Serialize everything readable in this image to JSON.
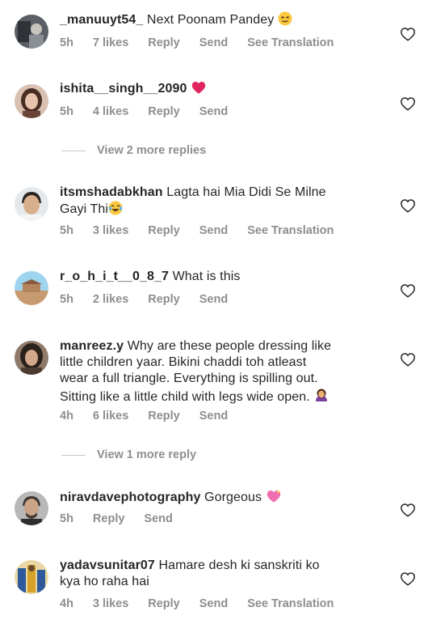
{
  "comments": [
    {
      "username": "_manuuyt54_",
      "text": "Next Poonam Pandey",
      "emoji": "persevering-face",
      "time": "5h",
      "likes": "7 likes",
      "reply": "Reply",
      "send": "Send",
      "translation": "See Translation"
    },
    {
      "username": "ishita__singh__2090",
      "text": "",
      "emoji": "red-heart",
      "time": "5h",
      "likes": "4 likes",
      "reply": "Reply",
      "send": "Send"
    },
    {
      "username": "itsmshadabkhan",
      "text": "Lagta hai Mia Didi Se Milne",
      "text_line2": "Gayi Thi",
      "emoji": "tears-of-joy",
      "time": "5h",
      "likes": "3 likes",
      "reply": "Reply",
      "send": "Send",
      "translation": "See Translation"
    },
    {
      "username": "r_o_h_i_t__0_8_7",
      "text": "What is this",
      "time": "5h",
      "likes": "2 likes",
      "reply": "Reply",
      "send": "Send"
    },
    {
      "username": "manreez.y",
      "text": "Why are these people dressing like",
      "text_line2": "little children yaar. Bikini chaddi toh atleast",
      "text_line3": "wear a full triangle. Everything is spilling out.",
      "text_line4": "Sitting like a little child with legs wide open.",
      "emoji": "face-palm",
      "time": "4h",
      "likes": "6 likes",
      "reply": "Reply",
      "send": "Send"
    },
    {
      "username": "niravdavephotography",
      "text": "Gorgeous",
      "emoji": "sparkling-heart",
      "time": "5h",
      "reply": "Reply",
      "send": "Send"
    },
    {
      "username": "yadavsunitar07",
      "text": "Hamare desh ki sanskriti ko",
      "text_line2": "kya ho raha hai",
      "time": "4h",
      "likes": "3 likes",
      "reply": "Reply",
      "send": "Send",
      "translation": "See Translation"
    }
  ],
  "view_replies": [
    {
      "label": "View 2 more replies"
    },
    {
      "label": "View 1 more reply"
    }
  ],
  "colors": {
    "text": "#262626",
    "secondary": "#8e8e8e",
    "heart_emoji": "#e0245e",
    "sparkle_heart": "#f06fb0"
  }
}
